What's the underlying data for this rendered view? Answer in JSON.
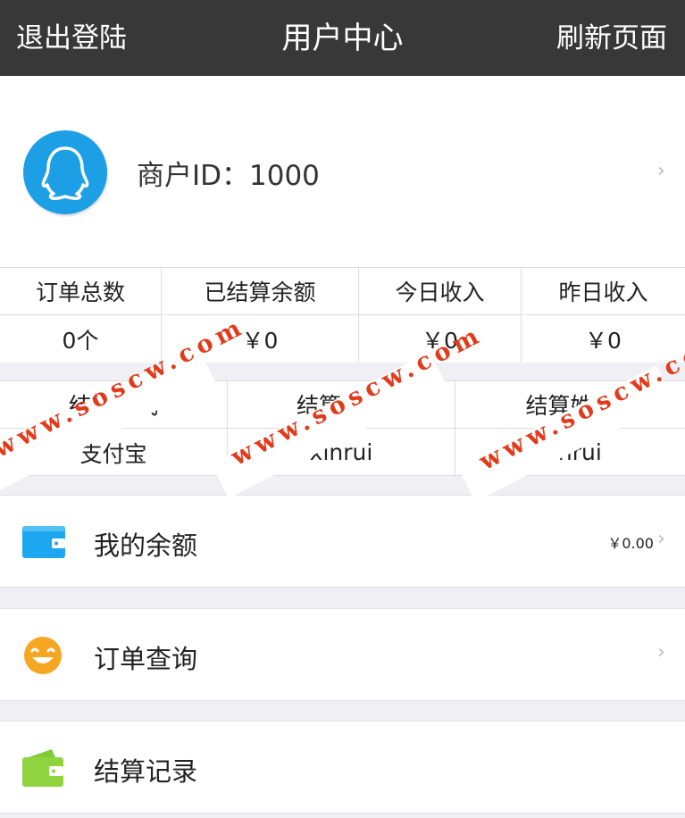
{
  "header": {
    "logout": "退出登陆",
    "title": "用户中心",
    "refresh": "刷新页面"
  },
  "profile": {
    "merchant_label": "商户ID：1000"
  },
  "stats": {
    "headers": [
      "订单总数",
      "已结算余额",
      "今日收入",
      "昨日收入"
    ],
    "values": [
      "0个",
      "￥0",
      "￥0",
      "￥0"
    ]
  },
  "settlement": {
    "headers": [
      "结算方式",
      "结算账号",
      "结算姓名"
    ],
    "values": [
      "支付宝",
      "xinrui",
      "xinrui"
    ]
  },
  "menu": [
    {
      "label": "我的余额",
      "value": "￥0.00",
      "icon": "wallet-icon"
    },
    {
      "label": "订单查询",
      "icon": "smiley-icon"
    },
    {
      "label": "结算记录",
      "icon": "green-wallet-icon"
    }
  ],
  "watermark": "www.soscw.com",
  "colors": {
    "header_bg": "#383838",
    "avatar_blue": "#1d9fe6",
    "watermark_red": "#e23b1b"
  }
}
